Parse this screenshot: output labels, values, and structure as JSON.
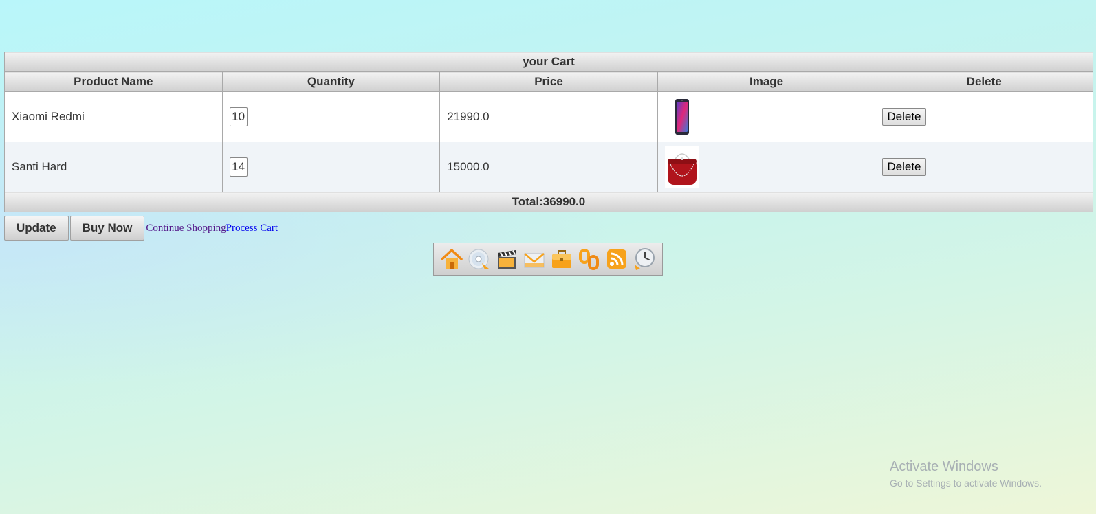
{
  "cart": {
    "title": "your Cart",
    "columns": [
      "Product Name",
      "Quantity",
      "Price",
      "Image",
      "Delete"
    ],
    "rows": [
      {
        "name": "Xiaomi Redmi",
        "quantity": "10",
        "price": "21990.0",
        "image": "phone-image",
        "delete_label": "Delete"
      },
      {
        "name": "Santi Hard",
        "quantity": "14",
        "price": "15000.0",
        "image": "red-handbag-image",
        "delete_label": "Delete"
      }
    ],
    "total": "Total:36990.0"
  },
  "actions": {
    "update_label": "Update",
    "buy_label": "Buy Now",
    "continue_link": "Continue Shopping",
    "process_link": "Process Cart"
  },
  "dock": {
    "icons": [
      "home-icon",
      "cd-icon",
      "clapperboard-icon",
      "mail-icon",
      "briefcase-icon",
      "link-icon",
      "rss-icon",
      "clock-icon"
    ]
  },
  "watermark": {
    "line1": "Activate Windows",
    "line2": "Go to Settings to activate Windows."
  },
  "colors": {
    "header_gradient_top": "#f2f2f2",
    "header_gradient_bottom": "#cfcfcf",
    "link": "#0000ee",
    "visited_link": "#551a8b",
    "icon_orange": "#f7a21b"
  }
}
